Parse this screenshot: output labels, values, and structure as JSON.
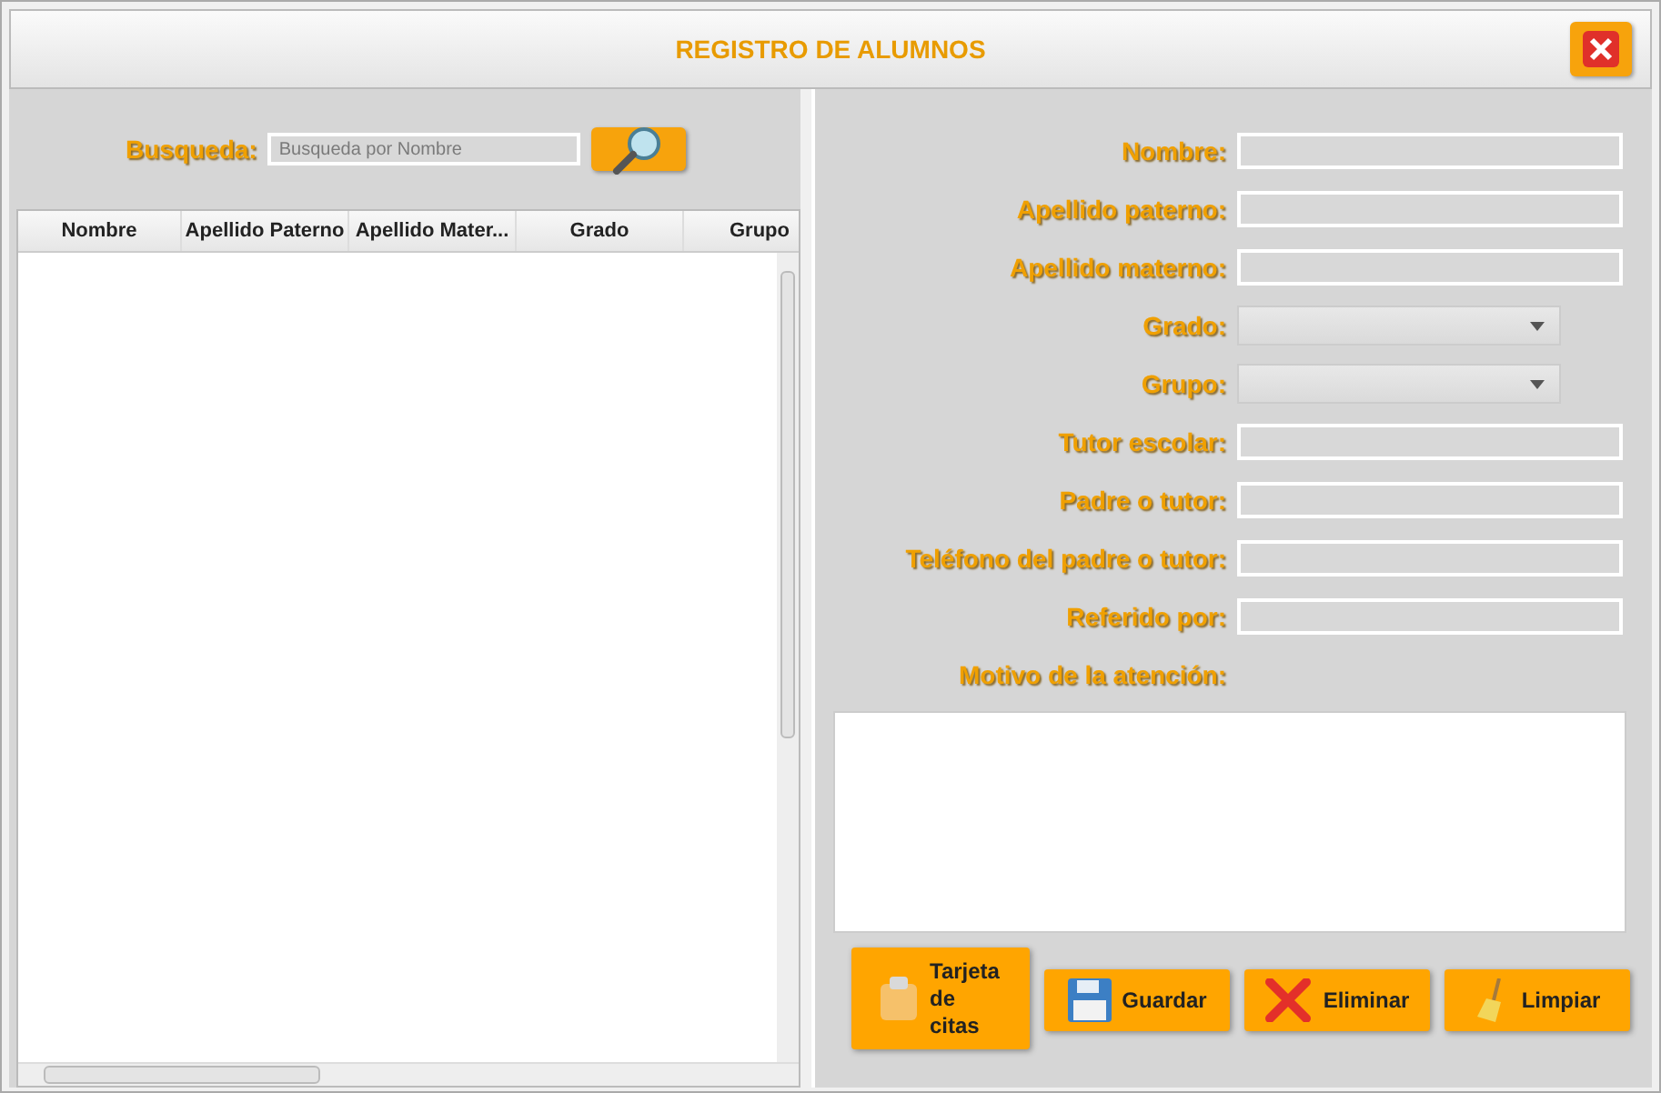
{
  "window": {
    "title": "REGISTRO DE ALUMNOS"
  },
  "search": {
    "label": "Busqueda:",
    "placeholder": "Busqueda por Nombre"
  },
  "table": {
    "columns": [
      "Nombre",
      "Apellido Paterno",
      "Apellido Mater...",
      "Grado",
      "Grupo"
    ]
  },
  "form": {
    "fields": [
      {
        "label": "Nombre:",
        "kind": "text"
      },
      {
        "label": "Apellido paterno:",
        "kind": "text"
      },
      {
        "label": "Apellido materno:",
        "kind": "text"
      },
      {
        "label": "Grado:",
        "kind": "select"
      },
      {
        "label": "Grupo:",
        "kind": "select"
      },
      {
        "label": "Tutor escolar:",
        "kind": "text"
      },
      {
        "label": "Padre o tutor:",
        "kind": "text"
      },
      {
        "label": "Teléfono del padre o tutor:",
        "kind": "text"
      },
      {
        "label": "Referido por:",
        "kind": "text"
      }
    ],
    "notes_label": "Motivo de la atención:"
  },
  "buttons": [
    {
      "label": "Tarjeta de citas",
      "kind": "clipboard"
    },
    {
      "label": "Guardar",
      "kind": "save"
    },
    {
      "label": "Eliminar",
      "kind": "delete"
    },
    {
      "label": "Limpiar",
      "kind": "clean"
    }
  ]
}
